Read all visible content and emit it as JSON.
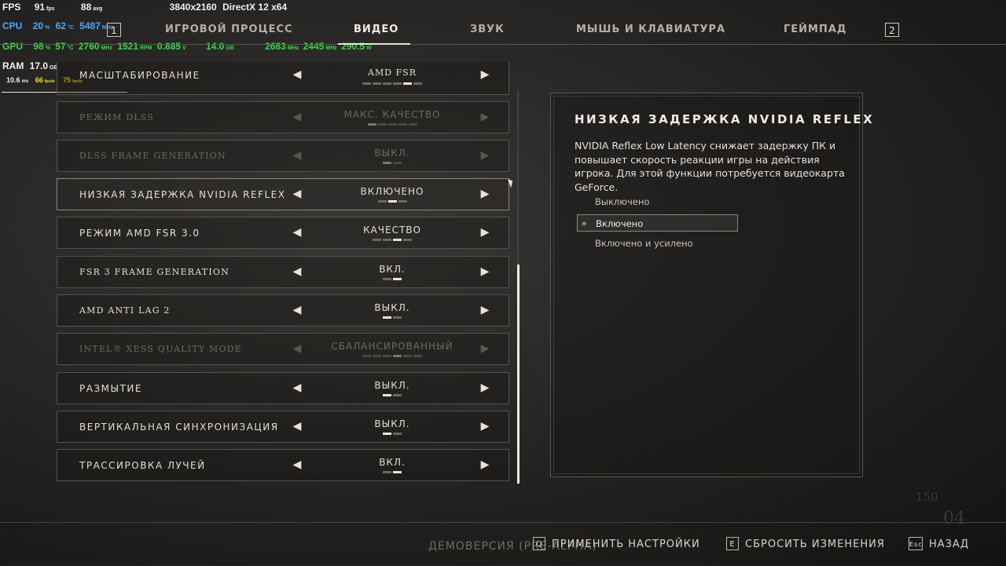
{
  "overlay": {
    "fps": {
      "label": "FPS",
      "value": "91",
      "unit": "fps",
      "avg": "88",
      "avg_unit": "avg",
      "resolution": "3840x2160",
      "api": "DirectX 12 x64"
    },
    "cpu": {
      "label": "CPU",
      "load": "20",
      "load_unit": "%",
      "temp": "62",
      "temp_unit": "°C",
      "clock": "5487",
      "clock_unit": "MHz"
    },
    "gpu": {
      "label": "GPU",
      "load": "98",
      "load_unit": "%",
      "temp": "57",
      "temp_unit": "°C",
      "clock": "2760",
      "clock_unit": "MHz",
      "fan": "1521",
      "fan_unit": "RPM",
      "voltage": "0.885",
      "voltage_unit": "V",
      "vram": "14.0",
      "vram_unit": "GB",
      "mem_clock": "2683",
      "mem_clock_unit": "MHz",
      "mem_clock2": "2445",
      "mem_clock2_unit": "MHz",
      "power": "290.5",
      "power_unit": "W"
    },
    "ram": {
      "label": "RAM",
      "value": "17.0",
      "unit": "GB"
    },
    "frametime": {
      "value": "10.6",
      "unit": "ms",
      "fps_per_watt": "66",
      "fps_per_watt_unit": "fps/w",
      "extra": "75",
      "extra_unit": "fps/w"
    }
  },
  "nav": {
    "left_key": "1",
    "right_key": "2",
    "tabs": [
      {
        "label": "ИГРОВОЙ ПРОЦЕСС"
      },
      {
        "label": "ВИДЕО"
      },
      {
        "label": "ЗВУК"
      },
      {
        "label": "МЫШЬ И КЛАВИАТУРА"
      },
      {
        "label": "ГЕЙМПАД"
      }
    ]
  },
  "settings": [
    {
      "label": "МАСШТАБИРОВАНИЕ",
      "value": "AMD FSR"
    },
    {
      "label": "РЕЖИМ DLSS",
      "value": "МАКС. КАЧЕСТВО"
    },
    {
      "label": "DLSS FRAME GENERATION",
      "value": "ВЫКЛ."
    },
    {
      "label": "НИЗКАЯ ЗАДЕРЖКА NVIDIA REFLEX",
      "value": "ВКЛЮЧЕНО"
    },
    {
      "label": "РЕЖИМ AMD FSR 3.0",
      "value": "КАЧЕСТВО"
    },
    {
      "label": "FSR 3 FRAME GENERATION",
      "value": "ВКЛ."
    },
    {
      "label": "AMD ANTI LAG 2",
      "value": "ВЫКЛ."
    },
    {
      "label": "INTEL® XESS QUALITY MODE",
      "value": "СБАЛАНСИРОВАННЫЙ"
    },
    {
      "label": "РАЗМЫТИЕ",
      "value": "ВЫКЛ."
    },
    {
      "label": "ВЕРТИКАЛЬНАЯ СИНХРОНИЗАЦИЯ",
      "value": "ВЫКЛ."
    },
    {
      "label": "ТРАССИРОВКА ЛУЧЕЙ",
      "value": "ВКЛ."
    }
  ],
  "detail": {
    "title": "НИЗКАЯ ЗАДЕРЖКА NVIDIA REFLEX",
    "description": "NVIDIA Reflex Low Latency снижает задержку ПК и повышает скорость реакции игры на действия игрока. Для этой функции потребуется видеокарта GeForce.",
    "options": [
      {
        "label": "Выключено"
      },
      {
        "label": "Включено"
      },
      {
        "label": "Включено и усилено"
      }
    ],
    "selected_index": 1
  },
  "footer": {
    "demo_label": "ДЕМОВЕРСИЯ (PRE-ALPHA)",
    "apply": {
      "key": "Q",
      "label": "ПРИМЕНИТЬ НАСТРОЙКИ"
    },
    "reset": {
      "key": "E",
      "label": "СБРОСИТЬ ИЗМЕНЕНИЯ"
    },
    "back": {
      "key": "Esc",
      "label": "НАЗАД"
    }
  },
  "background": {
    "hud_number_1": "150",
    "hud_number_2": "04"
  },
  "colors": {
    "cpu": "#4aa8ff",
    "gpu": "#33dd44",
    "highlight_yellow": "#f2e600",
    "text": "#e2ded6"
  }
}
